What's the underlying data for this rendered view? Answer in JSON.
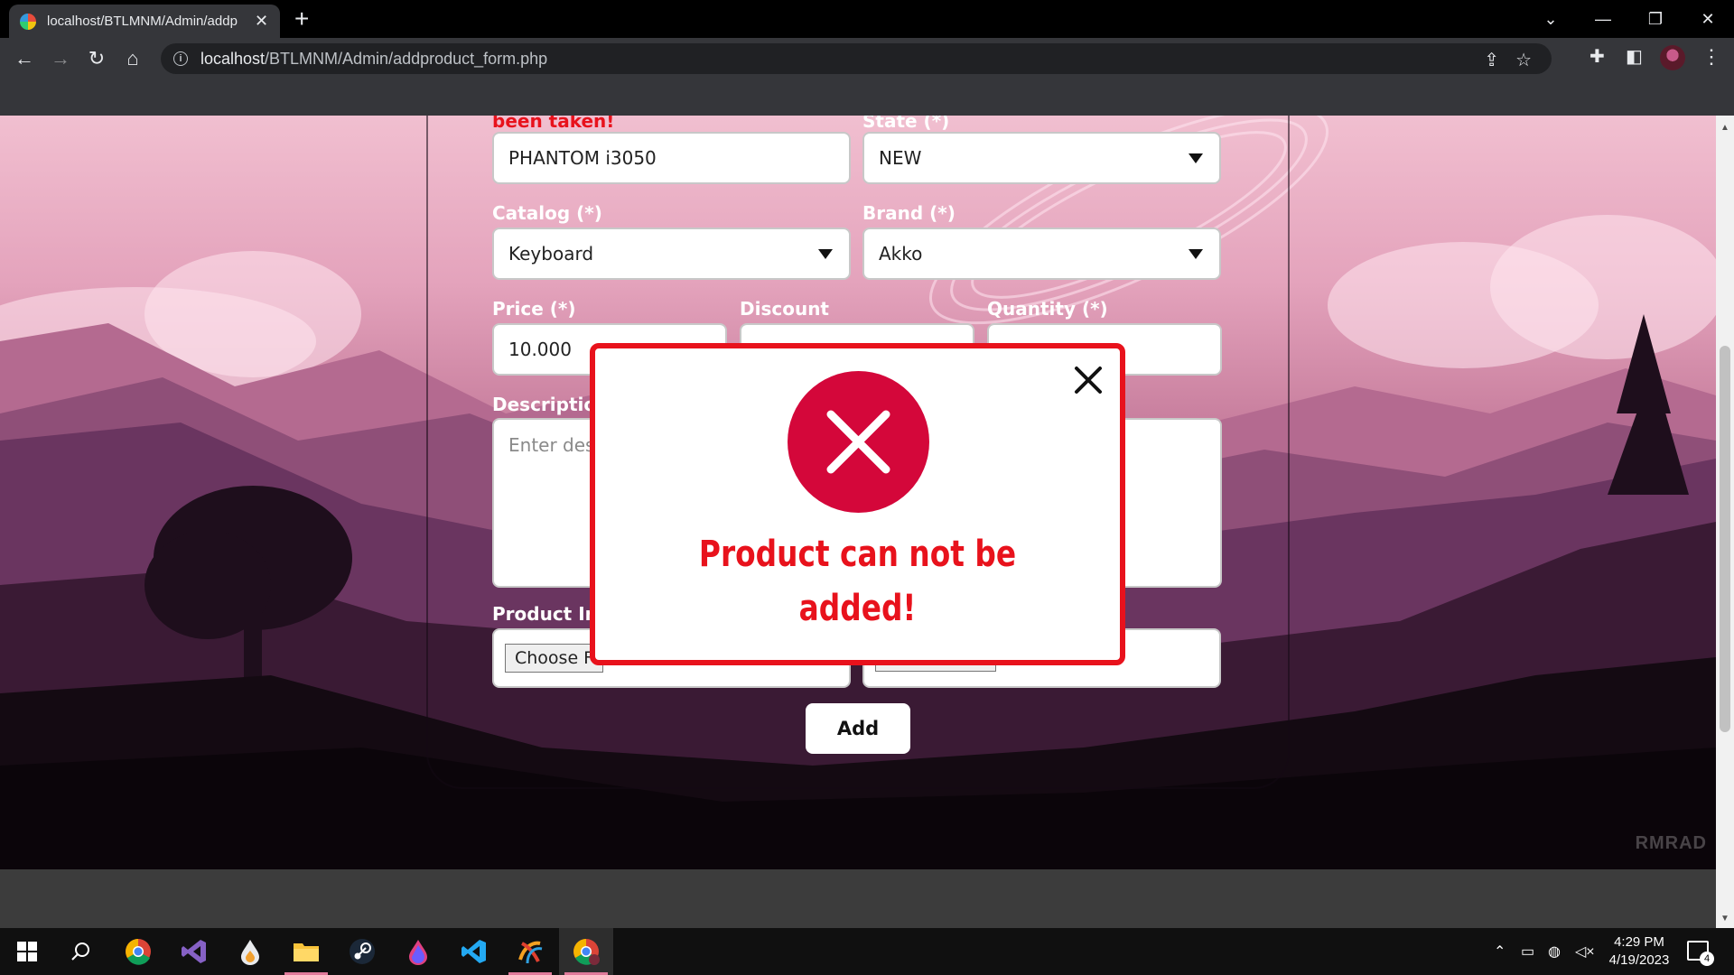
{
  "browser": {
    "tab_title": "localhost/BTLMNM/Admin/addp",
    "url_host": "localhost",
    "url_path": "/BTLMNM/Admin/addproduct_form.php"
  },
  "form": {
    "name_error": "been taken!",
    "name_value": "PHANTOM i3050",
    "state_label": "State (*)",
    "state_value": "NEW",
    "catalog_label": "Catalog (*)",
    "catalog_value": "Keyboard",
    "brand_label": "Brand (*)",
    "brand_value": "Akko",
    "price_label": "Price (*)",
    "price_value": "10.000",
    "discount_label": "Discount",
    "quantity_label": "Quantity (*)",
    "description_label": "Descriptio",
    "description_placeholder": "Enter des",
    "image_label": "Product Im",
    "choose_file_label": "Choose F",
    "add_label": "Add"
  },
  "modal": {
    "message_line1": "Product can not be",
    "message_line2": "added!"
  },
  "watermark": "RMRAD",
  "taskbar": {
    "time": "4:29 PM",
    "date": "4/19/2023",
    "notification_count": "4"
  },
  "colors": {
    "error_red": "#e8121c",
    "modal_circle": "#d4073a"
  }
}
